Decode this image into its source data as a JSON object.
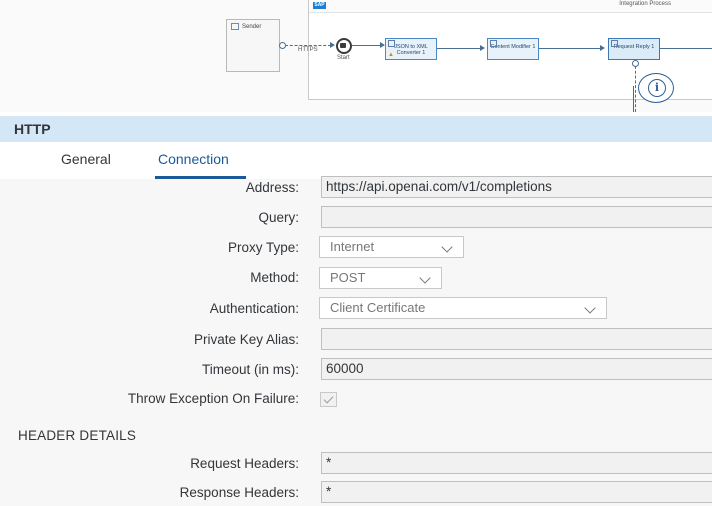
{
  "canvas": {
    "sender_label": "Sender",
    "channel_label": "HTTPS",
    "start_label": "Start",
    "pool_title": "Integration Process",
    "sap_logo_text": "SAP",
    "steps": [
      {
        "name": "json-to-xml-converter",
        "label": "JSON to XML Converter 1"
      },
      {
        "name": "content-modifier",
        "label": "Content Modifier 1"
      },
      {
        "name": "request-reply",
        "label": "Request Reply 1"
      }
    ],
    "info_icon_glyph": "i"
  },
  "panel": {
    "title": "HTTP",
    "tabs": [
      "General",
      "Connection"
    ],
    "active_tab": "Connection"
  },
  "form": {
    "address": {
      "label": "Address:",
      "value": "https://api.openai.com/v1/completions"
    },
    "query": {
      "label": "Query:",
      "value": ""
    },
    "proxy_type": {
      "label": "Proxy Type:",
      "value": "Internet"
    },
    "method": {
      "label": "Method:",
      "value": "POST"
    },
    "authentication": {
      "label": "Authentication:",
      "value": "Client Certificate"
    },
    "private_key_alias": {
      "label": "Private Key Alias:",
      "value": ""
    },
    "timeout": {
      "label": "Timeout (in ms):",
      "value": "60000"
    },
    "throw_exception": {
      "label": "Throw Exception On Failure:",
      "checked": true
    },
    "header_details": {
      "title": "HEADER DETAILS",
      "request_headers": {
        "label": "Request Headers:",
        "value": "*"
      },
      "response_headers": {
        "label": "Response Headers:",
        "value": "*"
      }
    }
  }
}
